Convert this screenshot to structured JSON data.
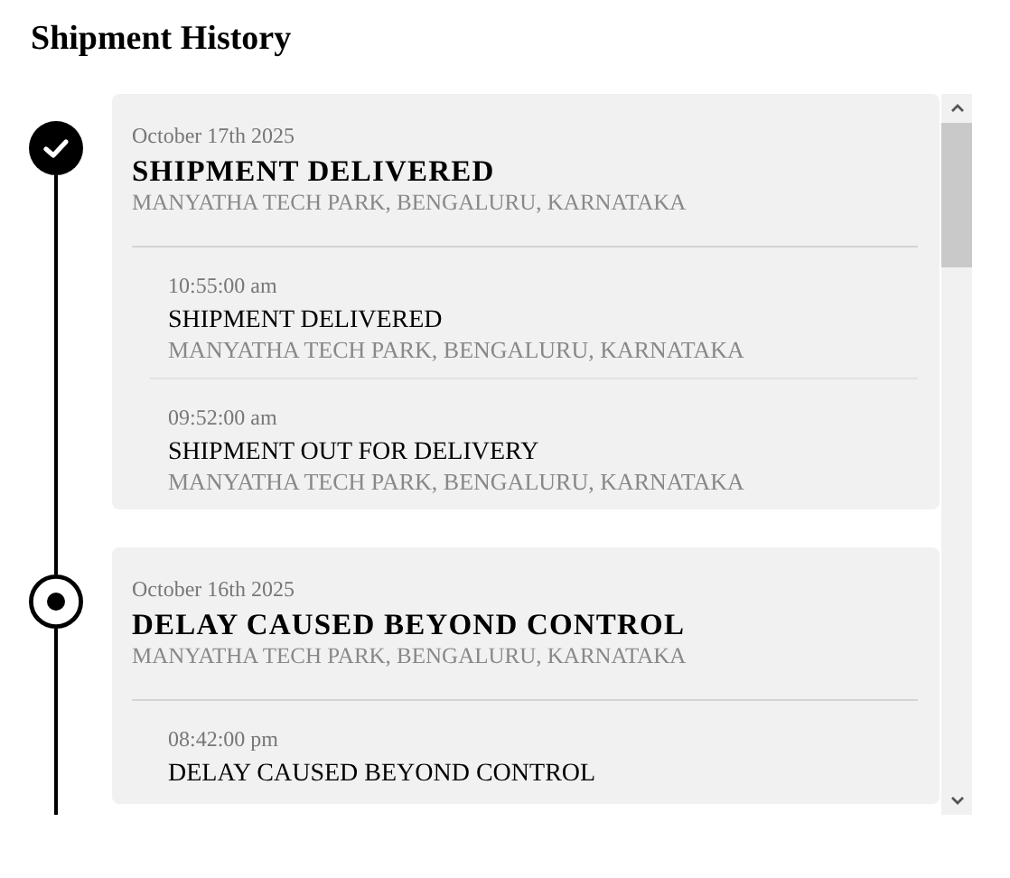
{
  "title": "Shipment History",
  "entries": [
    {
      "kind": "delivered",
      "date": "October 17th 2025",
      "status": "SHIPMENT DELIVERED",
      "location": "MANYATHA TECH PARK, BENGALURU, KARNATAKA",
      "events": [
        {
          "time": "10:55:00 am",
          "status": "SHIPMENT DELIVERED",
          "location": "MANYATHA TECH PARK, BENGALURU, KARNATAKA"
        },
        {
          "time": "09:52:00 am",
          "status": "SHIPMENT OUT FOR DELIVERY",
          "location": "MANYATHA TECH PARK, BENGALURU, KARNATAKA"
        }
      ]
    },
    {
      "kind": "current",
      "date": "October 16th 2025",
      "status": "DELAY CAUSED BEYOND CONTROL",
      "location": "MANYATHA TECH PARK, BENGALURU, KARNATAKA",
      "events": [
        {
          "time": "08:42:00 pm",
          "status": "DELAY CAUSED BEYOND CONTROL"
        }
      ]
    }
  ]
}
